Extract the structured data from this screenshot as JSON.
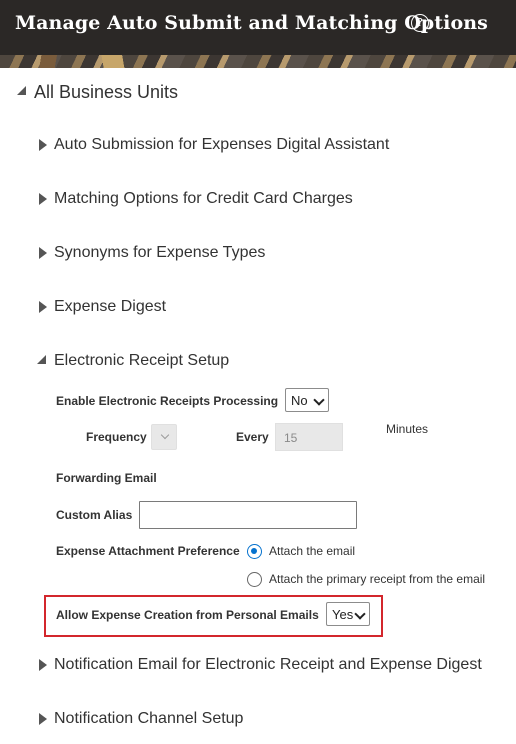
{
  "header": {
    "title": "Manage Auto Submit and Matching Options",
    "help_icon": "question-circle"
  },
  "tree": {
    "root_label": "All Business Units",
    "nodes": [
      {
        "label": "Auto Submission for Expenses Digital Assistant",
        "expanded": false
      },
      {
        "label": "Matching Options for Credit Card Charges",
        "expanded": false
      },
      {
        "label": "Synonyms for Expense Types",
        "expanded": false
      },
      {
        "label": "Expense Digest",
        "expanded": false
      },
      {
        "label": "Electronic Receipt Setup",
        "expanded": true
      },
      {
        "label": "Notification Email for Electronic Receipt and Expense Digest",
        "expanded": false
      },
      {
        "label": "Notification Channel Setup",
        "expanded": false
      }
    ]
  },
  "receipt_setup": {
    "enable_label": "Enable Electronic Receipts Processing",
    "enable_value": "No",
    "frequency_label": "Frequency",
    "frequency_value": "",
    "every_label": "Every",
    "every_value": "15",
    "minutes_label": "Minutes",
    "forwarding_email_label": "Forwarding Email",
    "custom_alias_label": "Custom Alias",
    "custom_alias_value": "",
    "attachment_pref_label": "Expense Attachment Preference",
    "attachment_options": [
      {
        "label": "Attach the email",
        "selected": true
      },
      {
        "label": "Attach the primary receipt from the email",
        "selected": false
      }
    ],
    "personal_emails_label": "Allow Expense Creation from Personal Emails",
    "personal_emails_value": "Yes"
  },
  "colors": {
    "header_bg": "#2b2826",
    "radio_accent": "#0572ce",
    "highlight_border": "#d3262c"
  }
}
